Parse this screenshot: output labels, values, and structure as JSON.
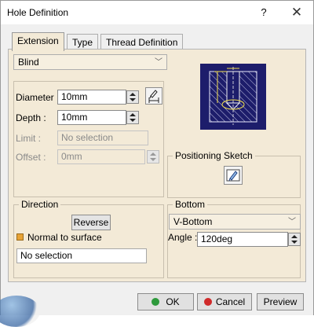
{
  "window": {
    "title": "Hole Definition",
    "help": "?",
    "close": "✕"
  },
  "tabs": [
    {
      "label": "Extension",
      "active": true
    },
    {
      "label": "Type",
      "active": false
    },
    {
      "label": "Thread Definition",
      "active": false
    }
  ],
  "extension": {
    "mode": "Blind",
    "diameter": {
      "label": "Diameter :",
      "value": "10mm"
    },
    "depth": {
      "label": "Depth :",
      "value": "10mm"
    },
    "limit": {
      "label": "Limit :",
      "value": "No selection"
    },
    "offset": {
      "label": "Offset :",
      "value": "0mm"
    },
    "diameter_icon": "diameter-dimension-icon",
    "preview_icon": "hole-section-preview-icon"
  },
  "positioning": {
    "title": "Positioning Sketch",
    "icon": "sketch-icon"
  },
  "direction": {
    "title": "Direction",
    "reverse_label": "Reverse",
    "normal_label": "Normal to surface",
    "normal_checked": true,
    "selection": "No selection"
  },
  "bottom": {
    "title": "Bottom",
    "type": "V-Bottom",
    "angle_label": "Angle :",
    "angle_value": "120deg"
  },
  "buttons": {
    "ok": "OK",
    "cancel": "Cancel",
    "preview": "Preview"
  },
  "colors": {
    "preview_bg": "#1d1d6b",
    "ok_dot": "#2e9a3c",
    "cancel_dot": "#d02a2a",
    "checkbox": "#e8a336"
  }
}
